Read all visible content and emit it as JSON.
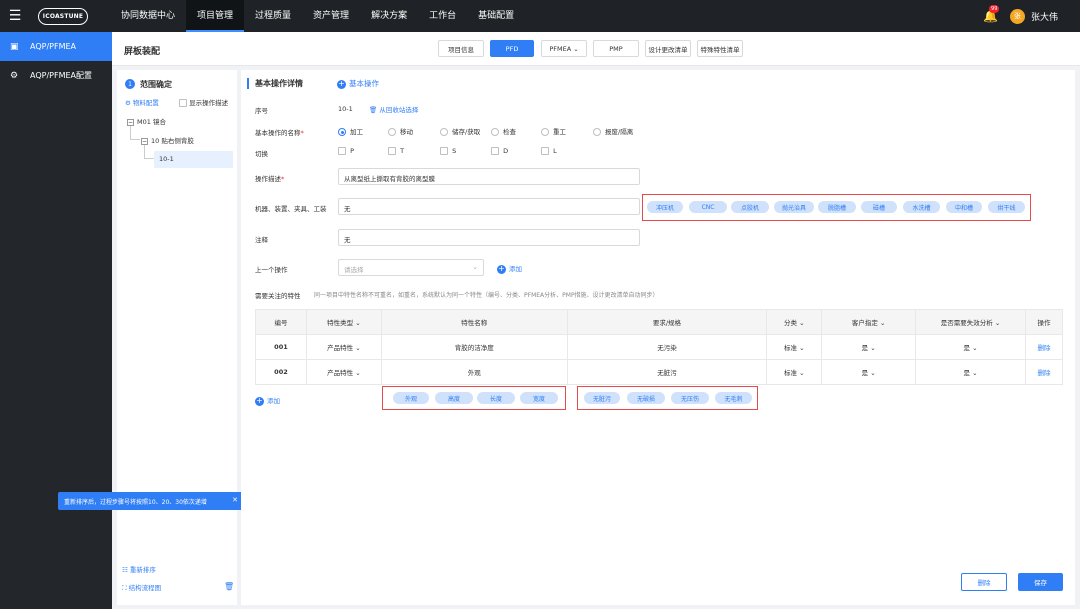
{
  "topbar": {
    "logo": "ICOASTUNE",
    "nav": [
      "协同数据中心",
      "项目管理",
      "过程质量",
      "资产管理",
      "解决方案",
      "工作台",
      "基础配置"
    ],
    "active_nav": "项目管理",
    "notif_count": "99",
    "avatar": "张",
    "user": "张大伟"
  },
  "sidebar": {
    "items": [
      "AQP/PFMEA",
      "AQP/PFMEA配置"
    ]
  },
  "header": {
    "title": "屏板装配",
    "tabs": [
      "项目信息",
      "PFD",
      "PFMEA",
      "PMP",
      "设计更改清单",
      "特殊特性清单"
    ],
    "active_tab": "PFD"
  },
  "left": {
    "step_num": "1",
    "step_title": "范围确定",
    "material": "物料配置",
    "show_desc": "显示操作描述",
    "tree": [
      "M01 镜合",
      "10 贴右侧背胶",
      "10-1"
    ],
    "reorder": "重新排序",
    "flowchart": "结构流程图",
    "tooltip": "重新排序后，过程步骤号将按照10、20、30依次递增"
  },
  "main": {
    "section_title": "基本操作详情",
    "basic_op": "基本操作",
    "seq_label": "序号",
    "seq_value": "10-1",
    "restore": "从回收站选择",
    "name_label": "基本操作的名称",
    "name_options": [
      "加工",
      "移动",
      "储存/获取",
      "检查",
      "重工",
      "报废/隔离"
    ],
    "name_selected": "加工",
    "switch_label": "切换",
    "switch_options": [
      "P",
      "T",
      "S",
      "D",
      "L"
    ],
    "desc_label": "操作描述",
    "desc_value": "从离型纸上撕取有背胶的离型膜",
    "tools_label": "机器、装置、夹具、工装",
    "tools_value": "无",
    "tool_tags": [
      "冲压机",
      "CNC",
      "点胶机",
      "抛光治具",
      "脱脂槽",
      "磁槽",
      "水洗槽",
      "中和槽",
      "烘干线"
    ],
    "note_label": "注释",
    "note_value": "无",
    "prev_label": "上一个操作",
    "prev_placeholder": "请选择",
    "add": "添加",
    "char_label": "需要关注的特性",
    "char_hint": "同一项目中特性名称不可重名，如重名，系统默认为同一个特性（编号、分类、PFMEA分析、PMP措施、设计更改清单自动同步）",
    "table": {
      "headers": [
        "编号",
        "特性类型",
        "特性名称",
        "要求/规格",
        "分类",
        "客户指定",
        "是否需要失效分析",
        "操作"
      ],
      "rows": [
        [
          "001",
          "产品特性",
          "背胶的洁净度",
          "无污染",
          "标准",
          "是",
          "是",
          "删除"
        ],
        [
          "002",
          "产品特性",
          "外观",
          "无脏污",
          "标准",
          "是",
          "是",
          "删除"
        ]
      ]
    },
    "table_add": "添加",
    "char_tags": [
      "外观",
      "高度",
      "长度",
      "宽度"
    ],
    "spec_tags": [
      "无脏污",
      "无破损",
      "无压伤",
      "无毛刺"
    ],
    "btn_delete": "删除",
    "btn_save": "保存"
  }
}
